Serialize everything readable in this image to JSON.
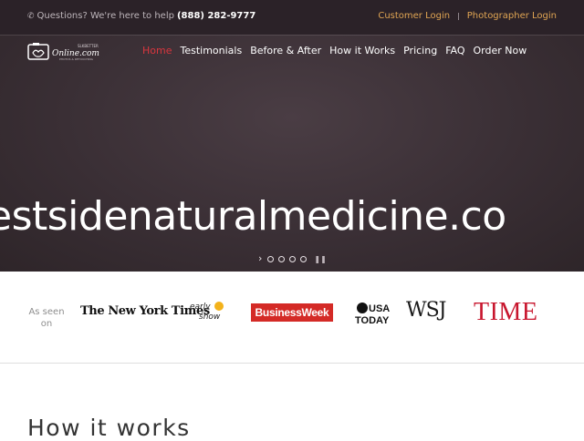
{
  "topbar": {
    "question_text": "Questions? We're here to help",
    "phone": "(888) 282-9777",
    "phone_icon": "phone-icon",
    "customer_login": "Customer Login",
    "separator": "|",
    "photographer_login": "Photographer Login",
    "accent_color": "#e0a553"
  },
  "logo": {
    "main_text": "Online.com",
    "top_text": "SLKBETTER",
    "sub_text": "PHOTOS & RETOUCHING"
  },
  "nav": {
    "items": [
      {
        "label": "Home",
        "active": true
      },
      {
        "label": "Testimonials",
        "active": false
      },
      {
        "label": "Before & After",
        "active": false
      },
      {
        "label": "How it Works",
        "active": false
      },
      {
        "label": "Pricing",
        "active": false
      },
      {
        "label": "FAQ",
        "active": false
      },
      {
        "label": "Order Now",
        "active": false
      }
    ],
    "active_color": "#d9363e"
  },
  "hero": {
    "text": "estsidenaturalmedicine.co",
    "next_icon": "chevron-right-icon",
    "dot_count": 4,
    "pause_icon": "pause-icon"
  },
  "press": {
    "label": "As seen on",
    "logos": {
      "nyt": "The New York Times",
      "early_show": "The early show",
      "businessweek": "BusinessWeek",
      "usa_today": "USA TODAY",
      "wsj": "WSJ",
      "time": "TIME"
    }
  },
  "section": {
    "title": "How it works"
  }
}
